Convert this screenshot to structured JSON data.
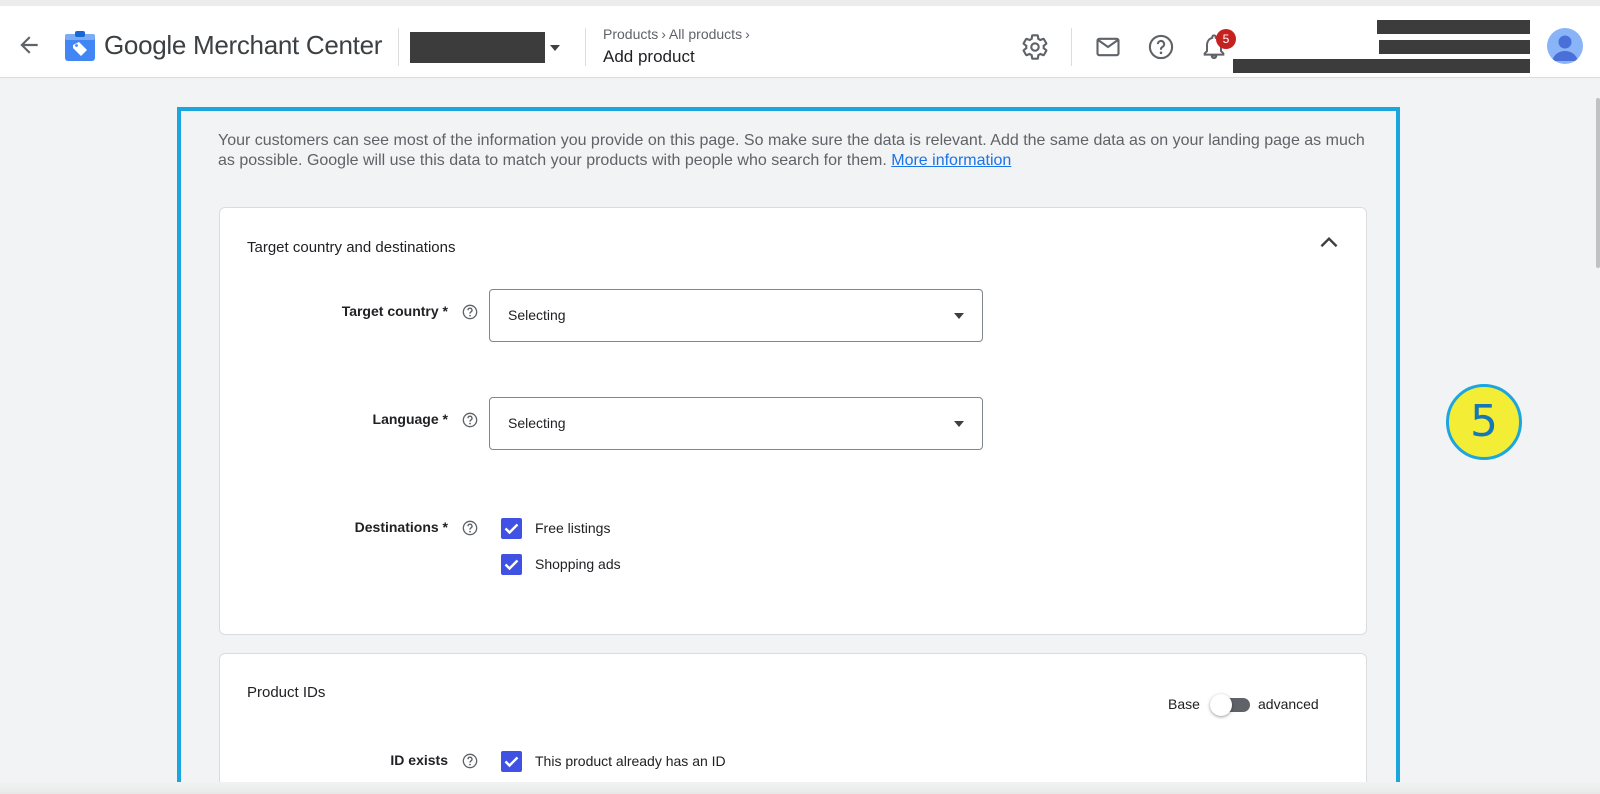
{
  "header": {
    "app_name": "Google Merchant Center",
    "breadcrumb": [
      "Products",
      "All products"
    ],
    "page_title": "Add product",
    "notification_count": "5",
    "brand_color": "#4285f4"
  },
  "intro": {
    "text": "Your customers can see most of the information you provide on this page. So make sure the data is relevant. Add the same data as on your landing page as much as possible. Google will use this data to match your products with people who search for them.",
    "link": "More information"
  },
  "target_section": {
    "title": "Target country and destinations",
    "target_country": {
      "label": "Target country *",
      "value": "Selecting"
    },
    "language": {
      "label": "Language *",
      "value": "Selecting"
    },
    "destinations": {
      "label": "Destinations *",
      "options": [
        {
          "label": "Free listings",
          "checked": true
        },
        {
          "label": "Shopping ads",
          "checked": true
        }
      ]
    }
  },
  "product_ids": {
    "title": "Product IDs",
    "toggle_left": "Base",
    "toggle_right": "advanced",
    "id_exists": {
      "label": "ID exists",
      "checkbox_label": "This product already has an ID",
      "checked": true
    }
  },
  "step_badge": "5",
  "colors": {
    "accent": "#1a73e8",
    "checkbox": "#4052e4",
    "highlight": "#1ba6e0",
    "badge": "#f4ed35"
  }
}
